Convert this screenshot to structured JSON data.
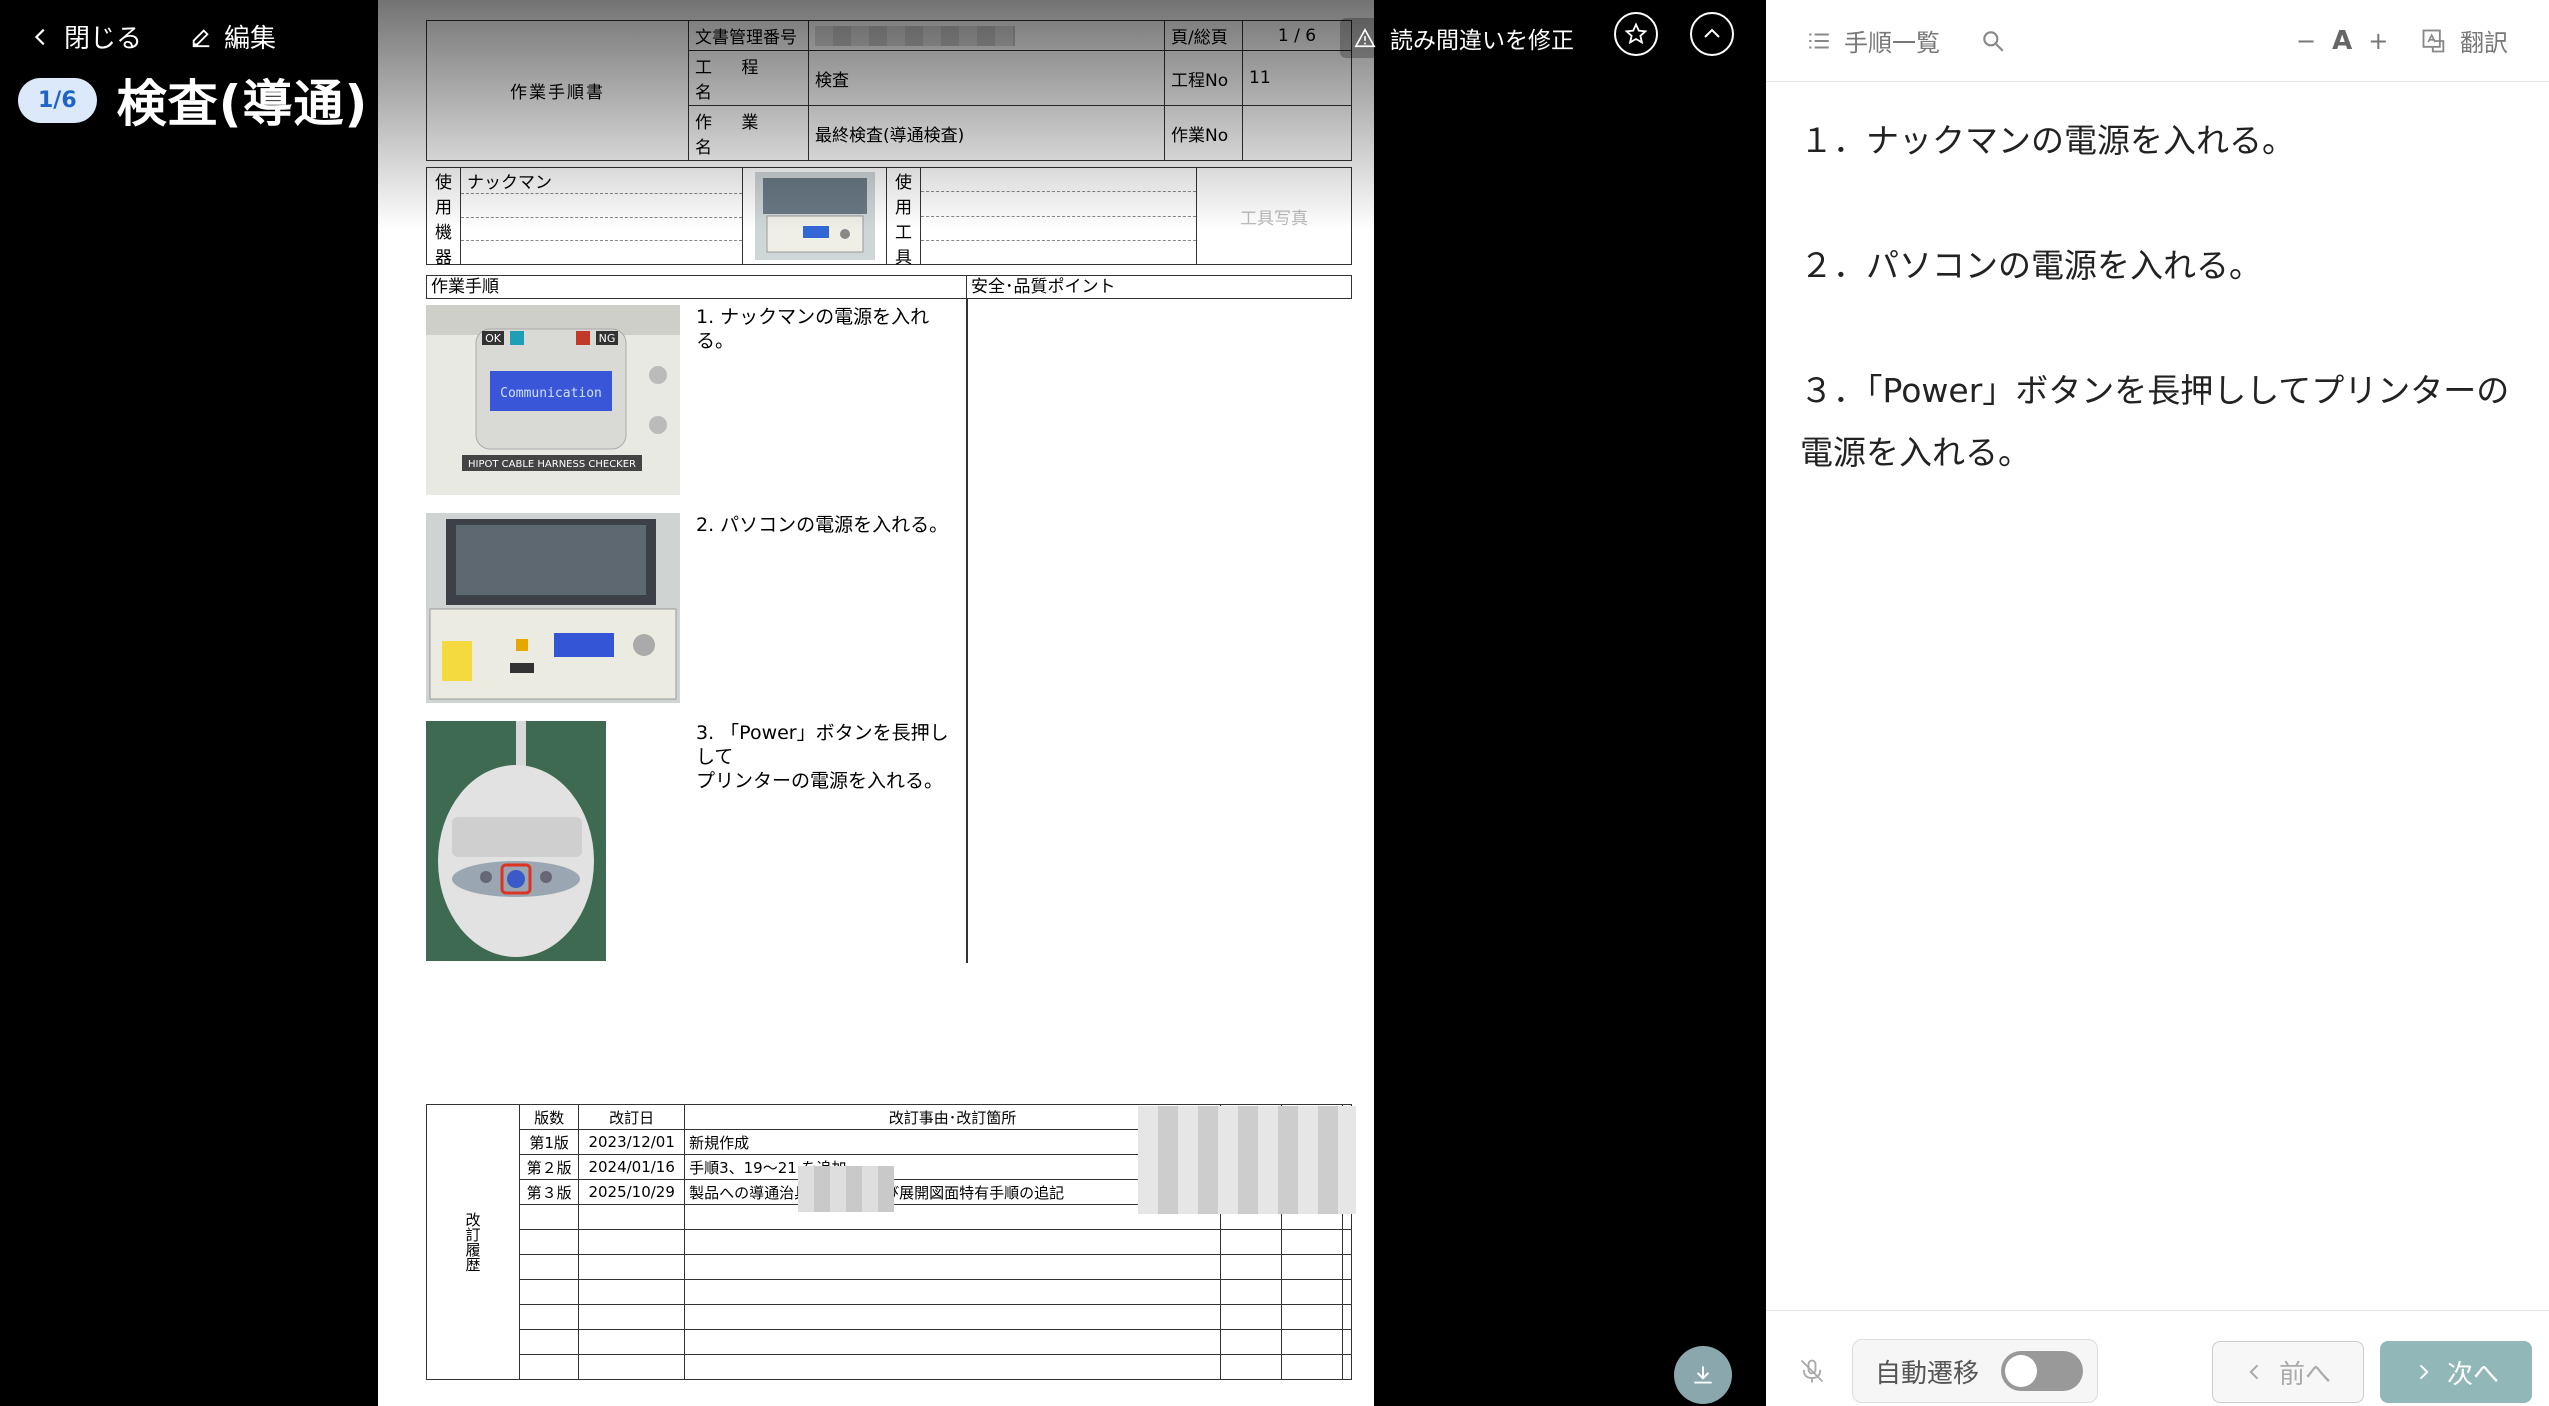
{
  "header": {
    "close_label": "閉じる",
    "edit_label": "編集",
    "page_badge": "1/6",
    "title": "検査(導通)"
  },
  "overlay": {
    "warn_label": "読み間違いを修正"
  },
  "doc": {
    "title": "作業手順書",
    "doc_no_label": "文書管理番号",
    "page_label": "頁/総頁",
    "page_value": "1 / 6",
    "process_label": "工 程 名",
    "process_value": "検査",
    "process_no_label": "工程No",
    "process_no_value": "11",
    "work_name_label": "作 業 名",
    "work_name_value": "最終検査(導通検査)",
    "work_no_label": "作業No",
    "equip_label_chars": [
      "使",
      "用",
      "機",
      "器"
    ],
    "equip_value": "ナックマン",
    "tool_label_chars": [
      "使",
      "用",
      "工",
      "具"
    ],
    "tool_photo_label": "工具写真",
    "steps_label": "作業手順",
    "safety_label": "安全･品質ポイント",
    "steps": [
      "1. ナックマンの電源を入れる。",
      "2. パソコンの電源を入れる。",
      "3. 「Power」ボタンを長押しして\nプリンターの電源を入れる。"
    ],
    "photo1": {
      "ok": "OK",
      "ng": "NG",
      "screen": "Communication",
      "caption": "HIPOT CABLE HARNESS CHECKER"
    },
    "revision": {
      "label": "改訂履歴",
      "headers": [
        "版数",
        "改訂日",
        "改訂事由･改訂箇所"
      ],
      "rows": [
        {
          "ver": "第1版",
          "date": "2023/12/01",
          "reason": "新規作成"
        },
        {
          "ver": "第２版",
          "date": "2024/01/16",
          "reason": "手順3、19～21 を追加"
        },
        {
          "ver": "第３版",
          "date": "2025/10/29",
          "reason": "製品への導通治具取付手順及び展開図面特有手順の追記"
        }
      ]
    }
  },
  "panel": {
    "list_label": "手順一覧",
    "font_minus": "−",
    "font_a": "A",
    "font_plus": "+",
    "translate_label": "翻訳",
    "steps": [
      "１．ナックマンの電源を入れる。",
      "２．パソコンの電源を入れる。",
      "３．「Power」ボタンを長押ししてプリンターの電源を入れる。"
    ],
    "auto_label": "自動遷移",
    "auto_enabled": false,
    "prev_label": "前へ",
    "next_label": "次へ"
  },
  "icons": [
    "chevron-left-icon",
    "pencil-icon",
    "warning-icon",
    "star-icon",
    "chevron-up-icon",
    "list-icon",
    "search-icon",
    "translate-icon",
    "mic-off-icon",
    "download-icon",
    "chevron-right-icon"
  ]
}
